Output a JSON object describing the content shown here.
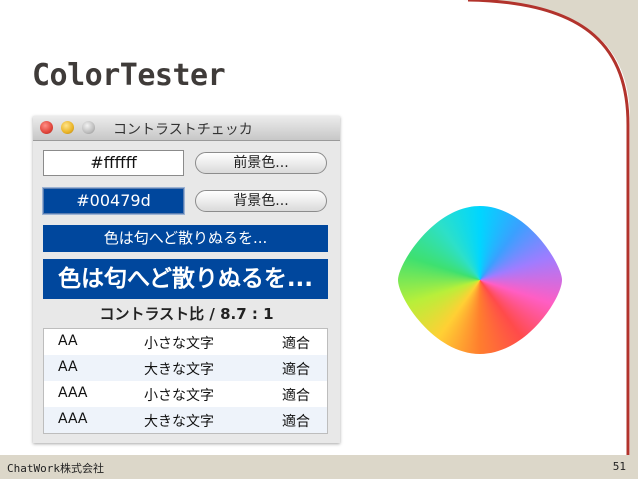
{
  "slide": {
    "title": "ColorTester",
    "footer_left": "ChatWork株式会社",
    "page_number": "51"
  },
  "window": {
    "title": "コントラストチェッカ",
    "foreground": {
      "value": "#ffffff",
      "button_label": "前景色..."
    },
    "background": {
      "value": "#00479d",
      "button_label": "背景色..."
    },
    "sample_text_small": "色は匂へど散りぬるを...",
    "sample_text_large": "色は匂へど散りぬるを...",
    "contrast_ratio": "コントラスト比 / 8.7 : 1",
    "results": [
      {
        "level": "AA",
        "text_size": "小さな文字",
        "verdict": "適合"
      },
      {
        "level": "AA",
        "text_size": "大きな文字",
        "verdict": "適合"
      },
      {
        "level": "AAA",
        "text_size": "小さな文字",
        "verdict": "適合"
      },
      {
        "level": "AAA",
        "text_size": "大きな文字",
        "verdict": "適合"
      }
    ]
  },
  "colors": {
    "foreground": "#ffffff",
    "background": "#00479d",
    "accent_red": "#b2332c"
  },
  "icons": [
    "close-traffic-light-icon",
    "minimize-traffic-light-icon",
    "zoom-traffic-light-icon",
    "color-wheel-icon"
  ]
}
